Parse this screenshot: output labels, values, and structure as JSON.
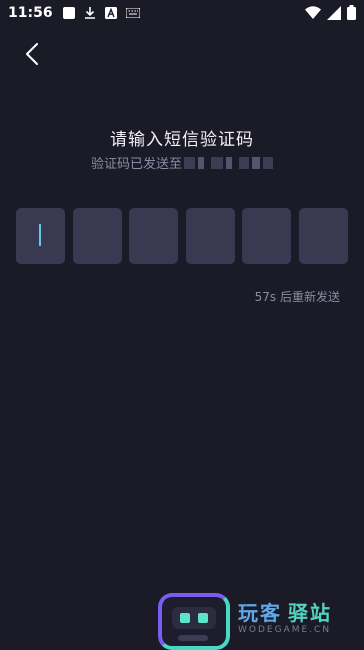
{
  "status_bar": {
    "time": "11:56"
  },
  "header": {
    "back_icon": "chevron-left-icon"
  },
  "main": {
    "title": "请输入短信验证码",
    "subtitle": "验证码已发送至",
    "code_length": 6,
    "resend_text": "57s 后重新发送"
  },
  "watermark": {
    "title_part1": "玩客",
    "title_part2": "驿站",
    "subtitle": "WODEGAME.CN"
  },
  "colors": {
    "background": "#1b1a27",
    "code_box": "#3a3952",
    "caret": "#5fc9e6",
    "muted_text": "#8d8ba3"
  }
}
